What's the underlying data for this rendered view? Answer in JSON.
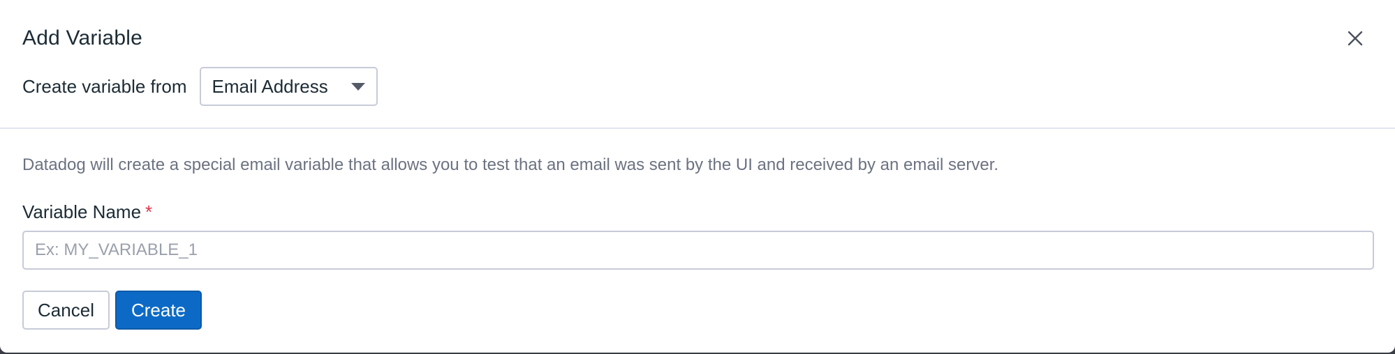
{
  "dialog": {
    "title": "Add Variable",
    "close_icon": "close-icon"
  },
  "source": {
    "label": "Create variable from",
    "selected": "Email Address",
    "caret_icon": "caret-down-icon"
  },
  "description": "Datadog will create a special email variable that allows you to test that an email was sent by the UI and received by an email server.",
  "variable_name": {
    "label": "Variable Name",
    "required_marker": "*",
    "placeholder": "Ex: MY_VARIABLE_1",
    "value": ""
  },
  "buttons": {
    "cancel": "Cancel",
    "create": "Create"
  },
  "colors": {
    "primary": "#0c6ac6",
    "required": "#e0334a",
    "border": "#c7cbd8",
    "text": "#1c2b34",
    "muted_text": "#6b7280"
  }
}
